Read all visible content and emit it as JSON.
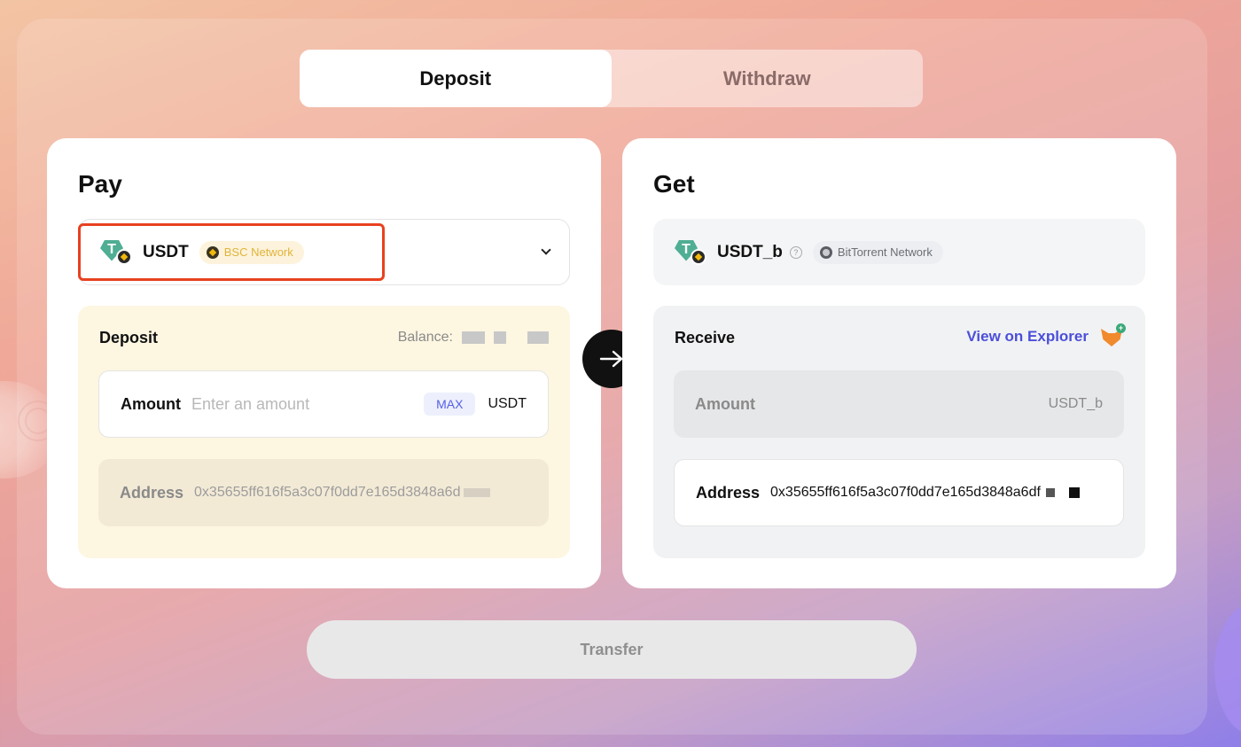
{
  "tabs": [
    {
      "label": "Deposit",
      "active": true
    },
    {
      "label": "Withdraw",
      "active": false
    }
  ],
  "pay": {
    "title": "Pay",
    "token": {
      "symbol": "USDT",
      "icon": "tether-bnb-icon",
      "network": "BSC Network"
    },
    "deposit": {
      "title": "Deposit",
      "balance_label": "Balance:",
      "amount_label": "Amount",
      "amount_placeholder": "Enter an amount",
      "max_label": "MAX",
      "unit": "USDT",
      "address_label": "Address",
      "address_value": "0x35655ff616f5a3c07f0dd7e165d3848a6d"
    }
  },
  "get": {
    "title": "Get",
    "token": {
      "symbol": "USDT_b",
      "icon": "tether-bnb-icon",
      "network": "BitTorrent Network"
    },
    "receive": {
      "title": "Receive",
      "explorer_label": "View on Explorer",
      "amount_label": "Amount",
      "unit": "USDT_b",
      "address_label": "Address",
      "address_value": "0x35655ff616f5a3c07f0dd7e165d3848a6df"
    }
  },
  "transfer_label": "Transfer",
  "colors": {
    "accent_link": "#4b4fd9",
    "highlight_box": "#e8411f",
    "bsc_chip": "#e0b43a",
    "tether": "#4fae93"
  }
}
